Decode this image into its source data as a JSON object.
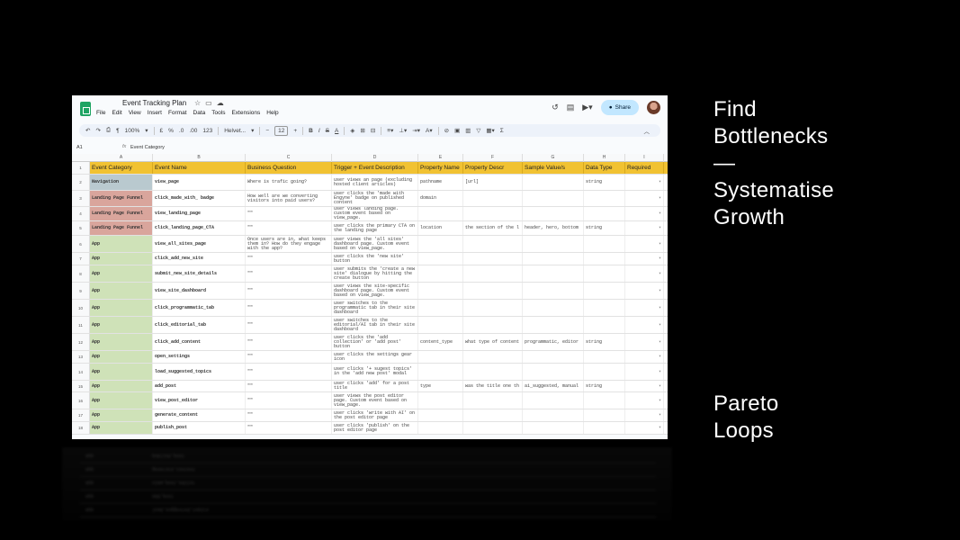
{
  "slide": {
    "side_top": [
      "Find",
      "Bottlenecks",
      "—",
      "Systematise",
      "Growth"
    ],
    "side_bottom": [
      "Pareto",
      "Loops"
    ]
  },
  "window": {
    "title": "Event Tracking Plan",
    "menus": [
      "File",
      "Edit",
      "View",
      "Insert",
      "Format",
      "Data",
      "Tools",
      "Extensions",
      "Help"
    ],
    "share_label": "Share",
    "colors": {
      "share_bg": "#c2e7ff",
      "header_row": "#f1c232",
      "navigation": "#b9c9cf",
      "landing": "#d9a59c",
      "app": "#cfe2b8"
    }
  },
  "toolbar": {
    "zoom": "100%",
    "currency": "£",
    "percent": "%",
    "dec_decrease": ".0",
    "dec_increase": ".00",
    "number_format": "123",
    "font": "Helvet...",
    "font_size": "12"
  },
  "formula_bar": {
    "cell_ref": "A1",
    "fx": "fx",
    "content": "Event Category"
  },
  "columns": [
    "A",
    "B",
    "C",
    "D",
    "E",
    "F",
    "G",
    "H",
    "I"
  ],
  "rows": [
    {
      "num": "1",
      "cells": [
        "Event Category",
        "Event Name",
        "Business Question",
        "Trigger + Event Description",
        "Property Name",
        "Property Descr",
        "Sample Value/s",
        "Data Type",
        "Required"
      ]
    },
    {
      "num": "2",
      "cat": "navigation",
      "cells": [
        "Navigation",
        "view_page",
        "Where is trafic going?",
        "user views an page (excluding hosted client articles)",
        "pathname",
        "[url]",
        "",
        "string",
        "▾"
      ]
    },
    {
      "num": "3",
      "cat": "landing",
      "cells": [
        "Landing Page Funnel",
        "click_made_with_ badge",
        "How well are we converting visitors into paid users?",
        "user clicks the 'made with Engyne' badge on published content",
        "domain",
        "",
        "",
        "",
        "▾"
      ]
    },
    {
      "num": "4",
      "cat": "landing",
      "cells": [
        "Landing Page Funnel",
        "view_landing_page",
        "\"\"",
        "user views landing page. custom event based on view_page.",
        "",
        "",
        "",
        "",
        "▾"
      ]
    },
    {
      "num": "5",
      "cat": "landing",
      "cells": [
        "Landing Page Funnel",
        "click_landing_page_CTA",
        "\"\"",
        "user clicks the primary CTA on the landing page",
        "location",
        "the section of the l",
        "header, hero, bottom",
        "string",
        "▾"
      ]
    },
    {
      "num": "6",
      "cat": "app",
      "cells": [
        "App",
        "view_all_sites_page",
        "Once users are in, what keeps them in? How do they engage with the app?",
        "user views the 'all sites' dashboard page. Custom event based on view_page.",
        "",
        "",
        "",
        "",
        "▾"
      ]
    },
    {
      "num": "7",
      "cat": "app",
      "cells": [
        "App",
        "click_add_new_site",
        "\"\"",
        "user clicks the 'new site' button",
        "",
        "",
        "",
        "",
        "▾"
      ]
    },
    {
      "num": "8",
      "cat": "app",
      "cells": [
        "App",
        "submit_new_site_details",
        "\"\"",
        "user submits the 'create a new site' dialogue by hitting the create button",
        "",
        "",
        "",
        "",
        "▾"
      ]
    },
    {
      "num": "9",
      "cat": "app",
      "cells": [
        "App",
        "view_site_dashboard",
        "\"\"",
        "user views the site-specific dashboard page. Custom event based on view_page.",
        "",
        "",
        "",
        "",
        "▾"
      ]
    },
    {
      "num": "10",
      "cat": "app",
      "cells": [
        "App",
        "click_programmatic_tab",
        "\"\"",
        "user switches to the programmatic tab in their site dashboard",
        "",
        "",
        "",
        "",
        "▾"
      ]
    },
    {
      "num": "11",
      "cat": "app",
      "cells": [
        "App",
        "click_editorial_tab",
        "\"\"",
        "user switches to the editorial/AI tab in their site dashboard",
        "",
        "",
        "",
        "",
        "▾"
      ]
    },
    {
      "num": "12",
      "cat": "app",
      "cells": [
        "App",
        "click_add_content",
        "\"\"",
        "user clicks the 'add collection' or 'add post' button",
        "content_type",
        "what type of content",
        "programmatic, editor",
        "string",
        "▾"
      ]
    },
    {
      "num": "13",
      "cat": "app",
      "cells": [
        "App",
        "open_settings",
        "\"\"",
        "user clicks the settings gear icon",
        "",
        "",
        "",
        "",
        "▾"
      ]
    },
    {
      "num": "14",
      "cat": "app",
      "cells": [
        "App",
        "load_suggested_topics",
        "\"\"",
        "user clicks '+ sugest topics' in the 'add new post' modal",
        "",
        "",
        "",
        "",
        "▾"
      ]
    },
    {
      "num": "15",
      "cat": "app",
      "cells": [
        "App",
        "add_post",
        "\"\"",
        "user clicks 'add' for a post title",
        "type",
        "was the title one th",
        "ai_suggested, manual",
        "string",
        "▾"
      ]
    },
    {
      "num": "16",
      "cat": "app",
      "cells": [
        "App",
        "view_post_editor",
        "\"\"",
        "user views the post editor page. Custom event based on view_page.",
        "",
        "",
        "",
        "",
        "▾"
      ]
    },
    {
      "num": "17",
      "cat": "app",
      "cells": [
        "App",
        "generate_content",
        "\"\"",
        "user clicks 'write with AI' on the post editor page",
        "",
        "",
        "",
        "",
        "▾"
      ]
    },
    {
      "num": "18",
      "cat": "app",
      "cells": [
        "App",
        "publish_post",
        "\"\"",
        "user clicks 'publish' on the post editor page",
        "",
        "",
        "",
        "",
        "▾"
      ]
    }
  ]
}
